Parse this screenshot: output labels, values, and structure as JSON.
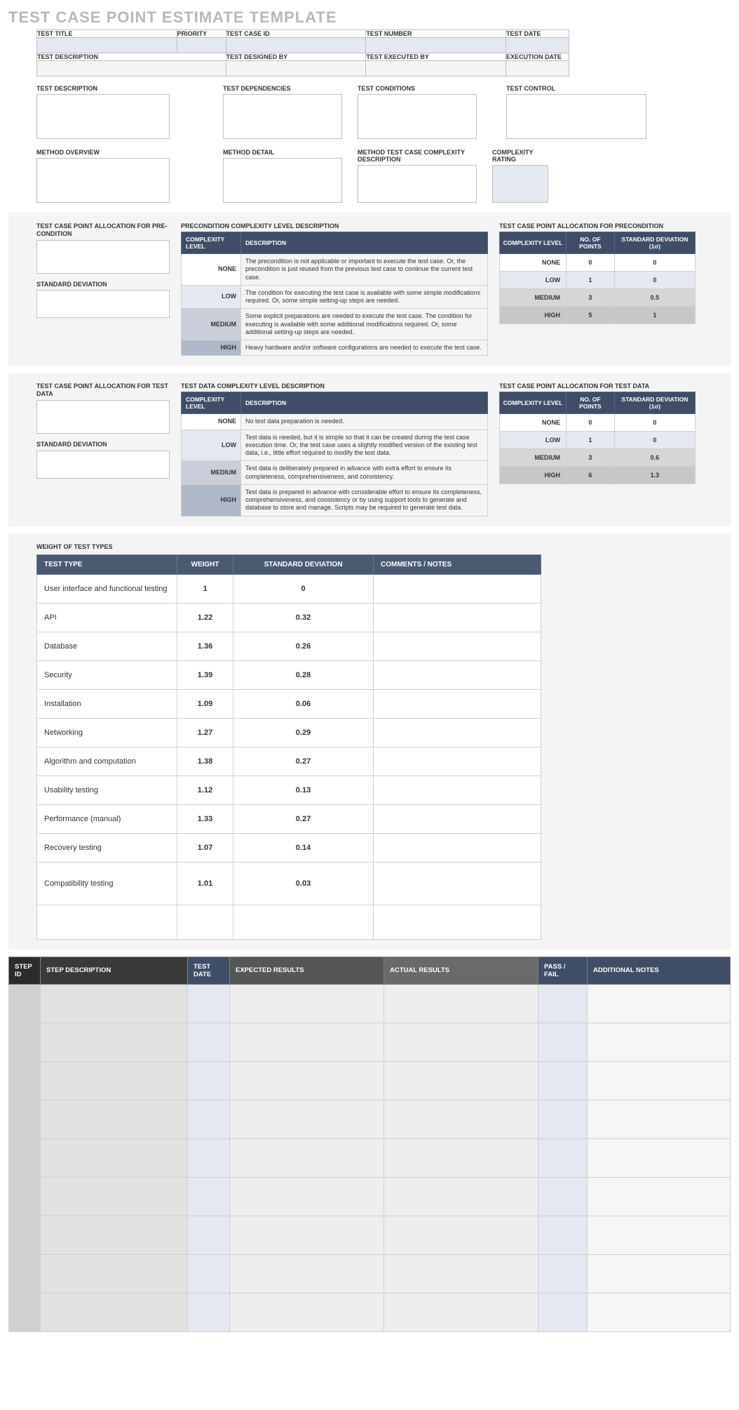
{
  "title": "TEST CASE POINT ESTIMATE TEMPLATE",
  "meta_row1": {
    "test_title": "TEST TITLE",
    "priority": "PRIORITY",
    "test_case_id": "TEST CASE ID",
    "test_number": "TEST NUMBER",
    "test_date": "TEST DATE"
  },
  "meta_row2": {
    "test_description": "TEST DESCRIPTION",
    "test_designed_by": "TEST DESIGNED BY",
    "test_executed_by": "TEST EXECUTED BY",
    "execution_date": "EXECUTION DATE"
  },
  "free1": {
    "test_description": "TEST DESCRIPTION",
    "test_dependencies": "TEST DEPENDENCIES",
    "test_conditions": "TEST CONDITIONS",
    "test_control": "TEST CONTROL"
  },
  "free2": {
    "method_overview": "METHOD OVERVIEW",
    "method_detail": "METHOD DETAIL",
    "method_complexity_desc": "METHOD TEST CASE COMPLEXITY DESCRIPTION",
    "complexity_rating": "COMPLEXITY RATING"
  },
  "precond": {
    "alloc_label": "TEST CASE POINT ALLOCATION FOR PRE-CONDITION",
    "stddev_label": "STANDARD DEVIATION",
    "desc_label": "PRECONDITION COMPLEXITY LEVEL DESCRIPTION",
    "alloc_table_label": "TEST CASE POINT ALLOCATION FOR PRECONDITION",
    "headers": {
      "level": "COMPLEXITY LEVEL",
      "desc": "DESCRIPTION",
      "points": "NO. OF POINTS",
      "stddev": "STANDARD DEVIATION (1σ)"
    },
    "rows": [
      {
        "level": "NONE",
        "desc": "The precondition is not applicable or important to execute the test case. Or, the precondition is just reused from the previous test case to continue the current test case.",
        "points": "0",
        "stddev": "0"
      },
      {
        "level": "LOW",
        "desc": "The condition for executing the test case is available with some simple modifications required. Or, some simple setting-up steps are needed.",
        "points": "1",
        "stddev": "0"
      },
      {
        "level": "MEDIUM",
        "desc": "Some explicit preparations are needed to execute the test case. The condition for executing is available with some additional modifications required. Or, some additional setting-up steps are needed.",
        "points": "3",
        "stddev": "0.5"
      },
      {
        "level": "HIGH",
        "desc": "Heavy hardware and/or software configurations are needed to execute the test case.",
        "points": "5",
        "stddev": "1"
      }
    ]
  },
  "testdata": {
    "alloc_label": "TEST CASE POINT ALLOCATION FOR TEST DATA",
    "stddev_label": "STANDARD DEVIATION",
    "desc_label": "TEST DATA COMPLEXITY LEVEL DESCRIPTION",
    "alloc_table_label": "TEST CASE POINT ALLOCATION FOR TEST DATA",
    "headers": {
      "level": "COMPLEXITY LEVEL",
      "desc": "DESCRIPTION",
      "points": "NO. OF POINTS",
      "stddev": "STANDARD DEVIATION (1σ)"
    },
    "rows": [
      {
        "level": "NONE",
        "desc": "No test data preparation is needed.",
        "points": "0",
        "stddev": "0"
      },
      {
        "level": "LOW",
        "desc": "Test data is needed, but it is simple so that it can be created during the test case execution time. Or, the test case uses a slightly modified version of the existing test data, i.e., little effort required to modify the test data.",
        "points": "1",
        "stddev": "0"
      },
      {
        "level": "MEDIUM",
        "desc": "Test data is deliberately prepared in advance with extra effort to ensure its completeness, comprehensiveness, and consistency.",
        "points": "3",
        "stddev": "0.6"
      },
      {
        "level": "HIGH",
        "desc": "Test data is prepared in advance with considerable effort to ensure its completeness, comprehensiveness, and consistency or by using support tools to generate and database to store and manage. Scripts may be required to generate test data.",
        "points": "6",
        "stddev": "1.3"
      }
    ]
  },
  "weights": {
    "label": "WEIGHT OF TEST TYPES",
    "headers": {
      "type": "TEST TYPE",
      "weight": "WEIGHT",
      "stddev": "STANDARD DEVIATION",
      "comments": "COMMENTS / NOTES"
    },
    "rows": [
      {
        "type": "User interface and functional testing",
        "weight": "1",
        "stddev": "0",
        "comments": ""
      },
      {
        "type": "API",
        "weight": "1.22",
        "stddev": "0.32",
        "comments": ""
      },
      {
        "type": "Database",
        "weight": "1.36",
        "stddev": "0.26",
        "comments": ""
      },
      {
        "type": "Security",
        "weight": "1.39",
        "stddev": "0.28",
        "comments": ""
      },
      {
        "type": "Installation",
        "weight": "1.09",
        "stddev": "0.06",
        "comments": ""
      },
      {
        "type": "Networking",
        "weight": "1.27",
        "stddev": "0.29",
        "comments": ""
      },
      {
        "type": "Algorithm and computation",
        "weight": "1.38",
        "stddev": "0.27",
        "comments": ""
      },
      {
        "type": "Usability testing",
        "weight": "1.12",
        "stddev": "0.13",
        "comments": ""
      },
      {
        "type": "Performance (manual)",
        "weight": "1.33",
        "stddev": "0.27",
        "comments": ""
      },
      {
        "type": "Recovery testing",
        "weight": "1.07",
        "stddev": "0.14",
        "comments": ""
      },
      {
        "type": "Compatibility testing",
        "weight": "1.01",
        "stddev": "0.03",
        "comments": "",
        "tall": true
      },
      {
        "type": "",
        "weight": "",
        "stddev": "",
        "comments": "",
        "tall": true
      }
    ]
  },
  "steps": {
    "headers": {
      "id": "STEP ID",
      "desc": "STEP DESCRIPTION",
      "date": "TEST DATE",
      "expected": "EXPECTED RESULTS",
      "actual": "ACTUAL RESULTS",
      "pass": "PASS / FAIL",
      "notes": "ADDITIONAL NOTES"
    },
    "row_count": 9
  }
}
